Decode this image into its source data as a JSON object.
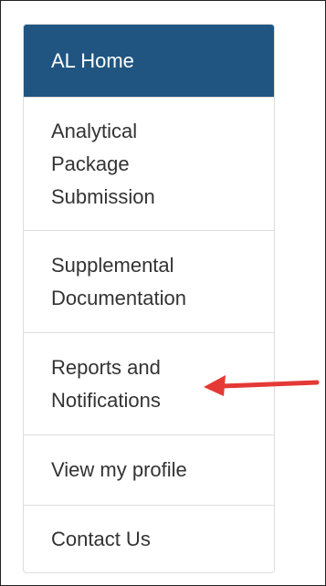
{
  "nav": {
    "items": [
      {
        "label": "AL Home",
        "active": true
      },
      {
        "label": "Analytical Package Submission",
        "active": false
      },
      {
        "label": "Supplemental Documentation",
        "active": false
      },
      {
        "label": "Reports and Notifications",
        "active": false
      },
      {
        "label": "View my profile",
        "active": false
      },
      {
        "label": "Contact Us",
        "active": false
      }
    ]
  },
  "colors": {
    "active_background": "#1f5580",
    "active_text": "#ffffff",
    "text": "#333333",
    "border": "#dddddd",
    "annotation_arrow": "#e53935"
  }
}
